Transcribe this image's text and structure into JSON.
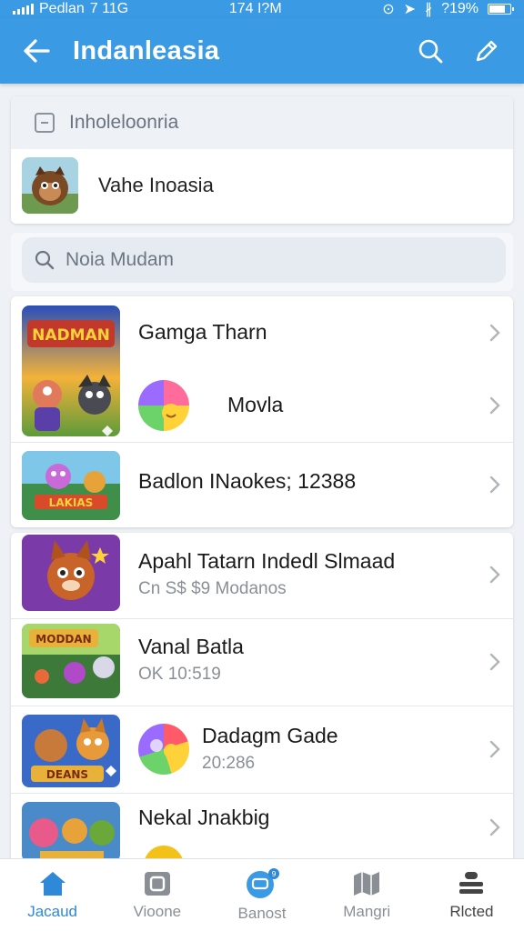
{
  "status_bar": {
    "carrier": "Pedlan",
    "network": "7 11G",
    "time": "174 I?M",
    "battery": "?19%"
  },
  "app_bar": {
    "title": "Indanleasia",
    "back_icon": "arrow-left-icon",
    "search_icon": "search-icon",
    "edit_icon": "pencil-icon"
  },
  "section": {
    "header_label": "Inholeloonria",
    "user_name": "Vahe Inoasia"
  },
  "search": {
    "placeholder": "Noia Mudam"
  },
  "list": [
    {
      "title": "Gamga Tharn",
      "subtitle": ""
    },
    {
      "title": "Movla",
      "subtitle": ""
    },
    {
      "title": "Badlon INaokes; 12388",
      "subtitle": ""
    },
    {
      "title": "Apahl Tatarn Indedl Slmaad",
      "subtitle": "Cn S$ $9 Modanos"
    },
    {
      "title": "Vanal Batla",
      "subtitle": "OK 10:519"
    },
    {
      "title": "Dadagm Gade",
      "subtitle": "20:286"
    },
    {
      "title": "Nekal Jnakbig",
      "subtitle": ""
    }
  ],
  "thumb_texts": {
    "t1": "NADMAN",
    "t2": "LAKIAS",
    "t5": "MODDAN",
    "t6": "DEANS"
  },
  "bottom_nav": [
    {
      "label": "Jacaud",
      "icon": "home-icon",
      "active": true
    },
    {
      "label": "Vioone",
      "icon": "video-icon",
      "active": false
    },
    {
      "label": "Banost",
      "icon": "chat-icon",
      "active": false
    },
    {
      "label": "Mangri",
      "icon": "map-icon",
      "active": false
    },
    {
      "label": "Rlcted",
      "icon": "stack-icon",
      "active": false
    }
  ],
  "colors": {
    "primary": "#3b9ae4",
    "active_nav": "#2f88d8"
  }
}
